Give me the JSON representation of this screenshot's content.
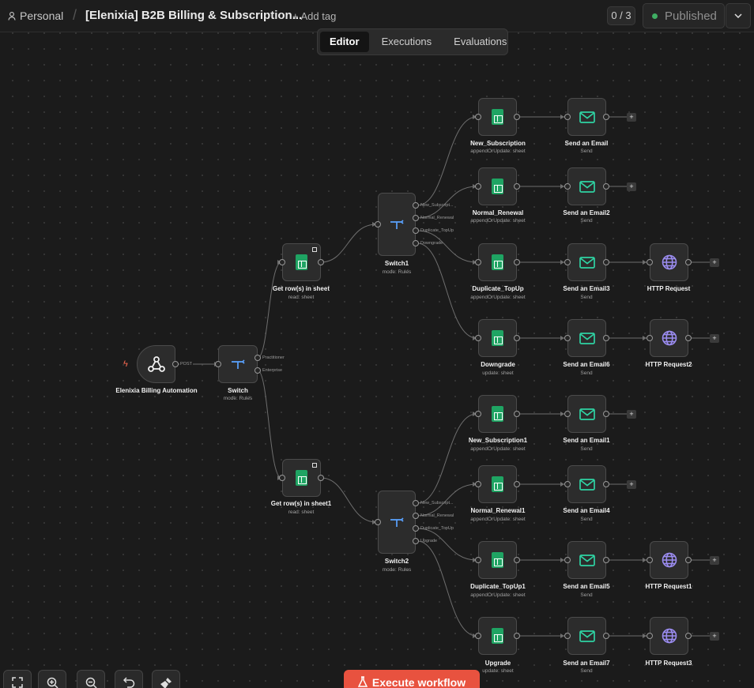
{
  "header": {
    "project": "Personal",
    "separator": "/",
    "title": "[Elenixia] B2B Billing & Subscription...",
    "add_tag": "+ Add tag",
    "counter": "0 / 3",
    "status": "Published",
    "status_color": "#3fae63"
  },
  "tabs": [
    "Editor",
    "Executions",
    "Evaluations"
  ],
  "active_tab": "Editor",
  "nodes": {
    "webhook": {
      "label": "Elenixia Billing Automation",
      "icon": "webhook-icon"
    },
    "switch": {
      "label": "Switch",
      "sub": "mode: Rules",
      "outputs": [
        "Practitioner",
        "Enterprise"
      ]
    },
    "get_rows": {
      "label": "Get row(s) in sheet",
      "sub": "read: sheet"
    },
    "get_rows1": {
      "label": "Get row(s) in sheet1",
      "sub": "read: sheet"
    },
    "switch1": {
      "label": "Switch1",
      "sub": "mode: Rules",
      "outputs": [
        "New_Subscript...",
        "Normal_Renewal",
        "Duplicate_TopUp",
        "Downgrade"
      ]
    },
    "switch2": {
      "label": "Switch2",
      "sub": "mode: Rules",
      "outputs": [
        "New_Subscript...",
        "Normal_Renewal",
        "Duplicate_TopUp",
        "Upgrade"
      ]
    },
    "new_sub": {
      "label": "New_Subscription",
      "sub": "appendOrUpdate: sheet"
    },
    "normal_renewal": {
      "label": "Normal_Renewal",
      "sub": "appendOrUpdate: sheet"
    },
    "dup_topup": {
      "label": "Duplicate_TopUp",
      "sub": "appendOrUpdate: sheet"
    },
    "downgrade": {
      "label": "Downgrade",
      "sub": "update: sheet"
    },
    "new_sub1": {
      "label": "New_Subscription1",
      "sub": "appendOrUpdate: sheet"
    },
    "normal_renewal1": {
      "label": "Normal_Renewal1",
      "sub": "appendOrUpdate: sheet"
    },
    "dup_topup1": {
      "label": "Duplicate_TopUp1",
      "sub": "appendOrUpdate: sheet"
    },
    "upgrade": {
      "label": "Upgrade",
      "sub": "update: sheet"
    },
    "email": {
      "label": "Send an Email",
      "sub": "Send"
    },
    "email2": {
      "label": "Send an Email2",
      "sub": "Send"
    },
    "email3": {
      "label": "Send an Email3",
      "sub": "Send"
    },
    "email6": {
      "label": "Send an Email6",
      "sub": "Send"
    },
    "email1": {
      "label": "Send an Email1",
      "sub": "Send"
    },
    "email4": {
      "label": "Send an Email4",
      "sub": "Send"
    },
    "email5": {
      "label": "Send an Email5",
      "sub": "Send"
    },
    "email7": {
      "label": "Send an Email7",
      "sub": "Send"
    },
    "http": {
      "label": "HTTP Request"
    },
    "http2": {
      "label": "HTTP Request2"
    },
    "http1": {
      "label": "HTTP Request1"
    },
    "http3": {
      "label": "HTTP Request3"
    }
  },
  "edge_labels": {
    "post": "POST"
  },
  "plus": "+",
  "execute_label": "Execute workflow",
  "colors": {
    "accent": "#e8523f",
    "sheets": "#1fa463",
    "email": "#2fd3a3",
    "http": "#9b8cf0",
    "switch": "#5aa2ff"
  }
}
